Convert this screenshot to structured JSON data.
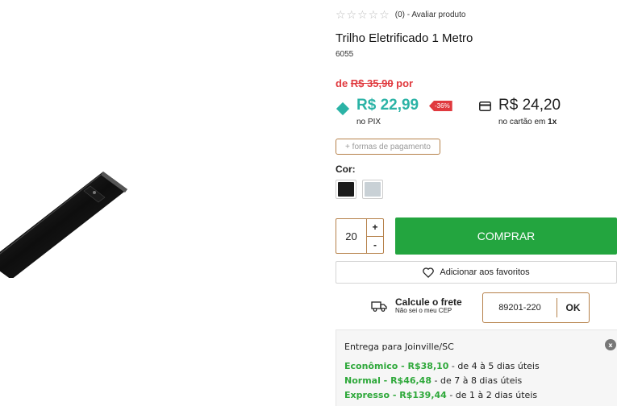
{
  "product": {
    "rating_stars": "☆☆☆☆☆",
    "rating_text": "(0) - Avaliar produto",
    "title": "Trilho Eletrificado 1 Metro",
    "sku": "6055",
    "image_icon": "black-electrified-track-rail"
  },
  "pricing": {
    "old_prefix": "de ",
    "old_price": "R$ 35,90",
    "old_suffix": " por",
    "pix_price": "R$ 22,99",
    "discount_badge": "-36%",
    "pix_label": "no PIX",
    "card_price": "R$ 24,20",
    "card_label": "no cartão em ",
    "card_installments": "1x",
    "pix_color": "#2bb3a6",
    "discount_color": "#e0393e"
  },
  "payment_button": "+ formas de pagamento",
  "color": {
    "label": "Cor:",
    "swatches": [
      {
        "name": "preto",
        "hex": "#1c1c1c"
      },
      {
        "name": "cinza",
        "hex": "#c9d1d6"
      }
    ]
  },
  "purchase": {
    "quantity": "20",
    "plus": "+",
    "minus": "-",
    "buy_label": "COMPRAR",
    "buy_color": "#23a53f",
    "favorite_label": "Adicionar aos favoritos"
  },
  "freight": {
    "title": "Calcule o frete",
    "subtitle": "Não sei o meu CEP",
    "cep_value": "89201-220",
    "ok_label": "OK"
  },
  "delivery": {
    "title": "Entrega para Joinville/SC",
    "close": "x",
    "options": [
      {
        "name": "Econômico - R$38,10",
        "detail": " - de 4 à  5 dias úteis"
      },
      {
        "name": "Normal - R$46,48",
        "detail": " - de 7 à  8 dias úteis"
      },
      {
        "name": "Expresso - R$139,44",
        "detail": " - de 1 à  2 dias úteis"
      }
    ]
  }
}
